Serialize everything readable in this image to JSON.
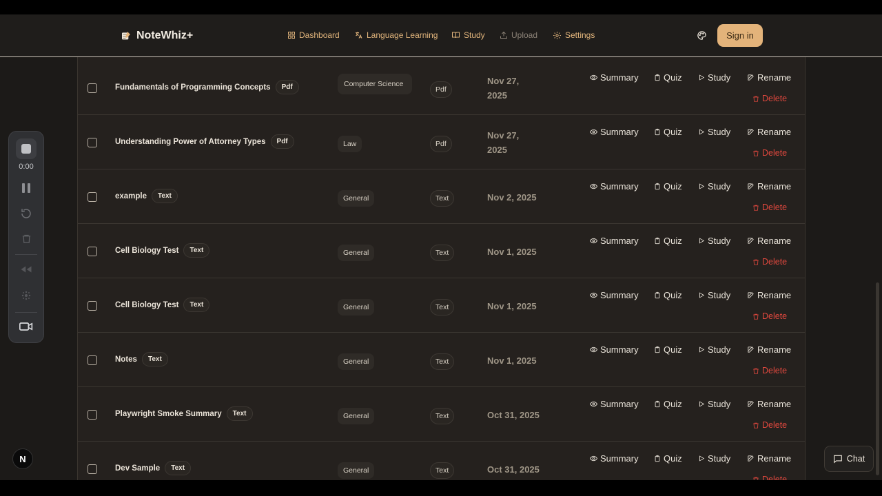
{
  "header": {
    "brand": "NoteWhiz+",
    "nav": [
      {
        "label": "Dashboard",
        "icon": "grid-icon"
      },
      {
        "label": "Language Learning",
        "icon": "translate-icon"
      },
      {
        "label": "Study",
        "icon": "book-icon"
      },
      {
        "label": "Upload",
        "icon": "upload-icon"
      },
      {
        "label": "Settings",
        "icon": "gear-icon"
      }
    ],
    "sign_in": "Sign in"
  },
  "actions": {
    "summary": "Summary",
    "quiz": "Quiz",
    "study": "Study",
    "rename": "Rename",
    "delete": "Delete"
  },
  "rows": [
    {
      "name": "Fundamentals of Programming Concepts",
      "badge": "Pdf",
      "category": "Computer Science",
      "type": "Pdf",
      "date": "Nov 27, 2025"
    },
    {
      "name": "Understanding Power of Attorney Types",
      "badge": "Pdf",
      "category": "Law",
      "type": "Pdf",
      "date": "Nov 27, 2025"
    },
    {
      "name": "example",
      "badge": "Text",
      "category": "General",
      "type": "Text",
      "date": "Nov 2, 2025"
    },
    {
      "name": "Cell Biology Test",
      "badge": "Text",
      "category": "General",
      "type": "Text",
      "date": "Nov 1, 2025"
    },
    {
      "name": "Cell Biology Test",
      "badge": "Text",
      "category": "General",
      "type": "Text",
      "date": "Nov 1, 2025"
    },
    {
      "name": "Notes",
      "badge": "Text",
      "category": "General",
      "type": "Text",
      "date": "Nov 1, 2025"
    },
    {
      "name": "Playwright Smoke Summary",
      "badge": "Text",
      "category": "General",
      "type": "Text",
      "date": "Oct 31, 2025"
    },
    {
      "name": "Dev Sample",
      "badge": "Text",
      "category": "General",
      "type": "Text",
      "date": "Oct 31, 2025"
    }
  ],
  "recorder": {
    "time": "0:00"
  },
  "floating": {
    "n_badge": "N",
    "chat": "Chat"
  },
  "colors": {
    "accent": "#e3b37a",
    "delete": "#e0483e",
    "background": "#1c1a18"
  }
}
